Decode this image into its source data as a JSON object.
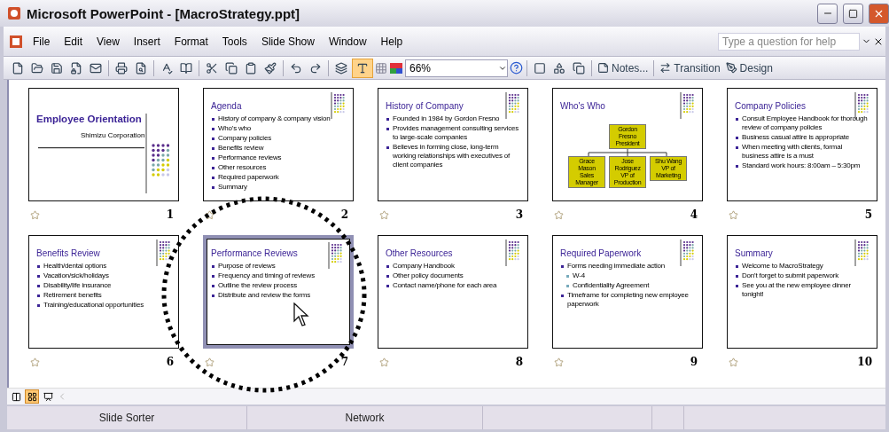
{
  "window": {
    "title": "Microsoft PowerPoint - [MacroStrategy.ppt]"
  },
  "menu": [
    "File",
    "Edit",
    "View",
    "Insert",
    "Format",
    "Tools",
    "Slide Show",
    "Window",
    "Help"
  ],
  "help_box": {
    "placeholder": "Type a question for help"
  },
  "toolbar": {
    "zoom": "66%",
    "formatting_toggle": {
      "on": true
    },
    "buttons": [
      {
        "kind": "notes",
        "label": "Notes..."
      },
      {
        "kind": "transition",
        "label": "Transition"
      },
      {
        "kind": "design",
        "label": "Design"
      }
    ]
  },
  "slides": [
    {
      "number": "1",
      "kind": "title",
      "selected": false,
      "pointer": false,
      "title": "Employee Orientation",
      "subtitle": "Shimizu Corporation"
    },
    {
      "number": "2",
      "kind": "bullets",
      "selected": false,
      "pointer": false,
      "title": "Agenda",
      "bullets": [
        {
          "text": "History of company & company vision"
        },
        {
          "text": "Who's who"
        },
        {
          "text": "Company policies"
        },
        {
          "text": "Benefits review"
        },
        {
          "text": "Performance reviews"
        },
        {
          "text": "Other resources"
        },
        {
          "text": "Required paperwork"
        },
        {
          "text": "Summary"
        }
      ]
    },
    {
      "number": "3",
      "kind": "bullets",
      "selected": false,
      "pointer": false,
      "title": "History of Company",
      "bullets": [
        {
          "text": "Founded in 1984 by Gordon Fresno"
        },
        {
          "text": "Provides management consulting services to large-scale companies"
        },
        {
          "text": "Believes in forming close, long-term working relationships with executives of client companies"
        }
      ]
    },
    {
      "number": "4",
      "kind": "org_chart",
      "selected": false,
      "pointer": false,
      "title": "Who's Who",
      "top": {
        "name": "Gordon Fresno",
        "role": "President"
      },
      "members": [
        {
          "name": "Grace Mason",
          "role": "Sales Manager"
        },
        {
          "name": "Jose Rodriguez",
          "role": "VP of Production"
        },
        {
          "name": "Shu Wang",
          "role": "VP of Marketing"
        }
      ]
    },
    {
      "number": "5",
      "kind": "bullets",
      "selected": false,
      "pointer": false,
      "title": "Company Policies",
      "bullets": [
        {
          "text": "Consult Employee Handbook for thorough review of company policies"
        },
        {
          "text": "Business casual attire is appropriate"
        },
        {
          "text": "When meeting with clients, formal business attire is a must"
        },
        {
          "text": "Standard work hours: 8:00am – 5:30pm"
        }
      ]
    },
    {
      "number": "6",
      "kind": "bullets",
      "selected": false,
      "pointer": false,
      "title": "Benefits Review",
      "bullets": [
        {
          "text": "Health/dental options"
        },
        {
          "text": "Vacation/sick/holidays"
        },
        {
          "text": "Disability/life insurance"
        },
        {
          "text": "Retirement benefits"
        },
        {
          "text": "Training/educational opportunities"
        }
      ]
    },
    {
      "number": "7",
      "kind": "bullets",
      "selected": true,
      "pointer": true,
      "circled": true,
      "title": "Performance Reviews",
      "bullets": [
        {
          "text": "Purpose of reviews"
        },
        {
          "text": "Frequency and timing of reviews"
        },
        {
          "text": "Outline the review process"
        },
        {
          "text": "Distribute and review the forms"
        }
      ]
    },
    {
      "number": "8",
      "kind": "bullets",
      "selected": false,
      "pointer": false,
      "title": "Other Resources",
      "bullets": [
        {
          "text": "Company Handbook"
        },
        {
          "text": "Other policy documents"
        },
        {
          "text": "Contact name/phone for each area"
        }
      ]
    },
    {
      "number": "9",
      "kind": "bullets",
      "selected": false,
      "pointer": false,
      "title": "Required Paperwork",
      "bullets": [
        {
          "text": "Forms needing immediate action",
          "children": [
            {
              "text": "W-4"
            },
            {
              "text": "Confidentiality Agreement"
            }
          ]
        },
        {
          "text": "Timeframe for completing new employee paperwork"
        }
      ]
    },
    {
      "number": "10",
      "kind": "bullets",
      "selected": false,
      "pointer": false,
      "title": "Summary",
      "bullets": [
        {
          "text": "Welcome to MacroStrategy"
        },
        {
          "text": "Don't forget to submit paperwork"
        },
        {
          "text": "See you at the new employee dinner tonight!"
        }
      ]
    }
  ],
  "views": [
    {
      "kind": "normal",
      "selected": false
    },
    {
      "kind": "sorter",
      "selected": true
    },
    {
      "kind": "show",
      "selected": false
    }
  ],
  "status_bar": [
    "Slide Sorter",
    "Network"
  ]
}
